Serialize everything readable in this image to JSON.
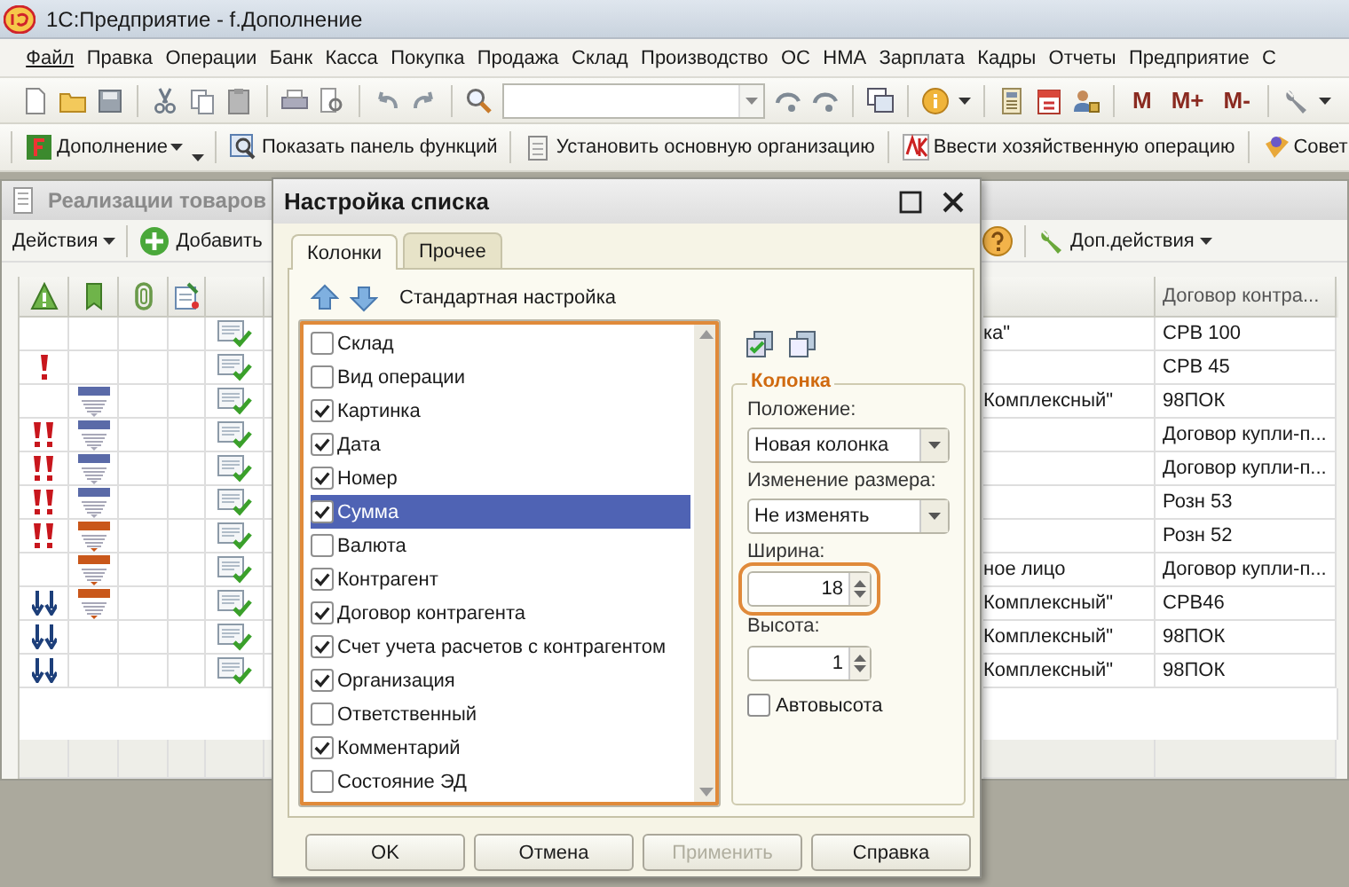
{
  "app": {
    "title": "1С:Предприятие - f.Дополнение"
  },
  "menu": [
    "Файл",
    "Правка",
    "Операции",
    "Банк",
    "Касса",
    "Покупка",
    "Продажа",
    "Склад",
    "Производство",
    "ОС",
    "НМА",
    "Зарплата",
    "Кадры",
    "Отчеты",
    "Предприятие",
    "С"
  ],
  "memory_buttons": [
    "M",
    "M+",
    "M-"
  ],
  "panel_buttons": [
    {
      "label": "Дополнение",
      "kind": "addon",
      "dropdown": true
    },
    {
      "label": "Показать панель функций",
      "kind": "panel",
      "dropdown": false
    },
    {
      "label": "Установить основную организацию",
      "kind": "organization",
      "dropdown": false
    },
    {
      "label": "Ввести хозяйственную операцию",
      "kind": "operation",
      "dropdown": false
    },
    {
      "label": "Совет",
      "kind": "tips",
      "dropdown": false
    }
  ],
  "document_window": {
    "title": "Реализации товаров",
    "actions": "Действия",
    "add": "Добавить",
    "more_actions": "Доп.действия",
    "header_contract": "Договор контра...",
    "rows": [
      {
        "counterparty": "ка\"",
        "contract": "СРВ 100"
      },
      {
        "priority": {
          "kind": "high"
        },
        "contract": "СРВ 45"
      },
      {
        "invoice": {
          "kind": "normal"
        },
        "counterparty": "Комплексный\"",
        "contract": "98ПОК"
      },
      {
        "priority": {
          "kind": "critical"
        },
        "invoice": {
          "kind": "normal"
        },
        "contract": "Договор купли-п..."
      },
      {
        "priority": {
          "kind": "critical"
        },
        "invoice": {
          "kind": "normal"
        },
        "contract": "Договор купли-п..."
      },
      {
        "priority": {
          "kind": "critical"
        },
        "invoice": {
          "kind": "normal"
        },
        "contract": "Розн 53"
      },
      {
        "priority": {
          "kind": "critical"
        },
        "invoice": {
          "kind": "attention"
        },
        "contract": "Розн 52"
      },
      {
        "invoice": {
          "kind": "attention"
        },
        "counterparty": "ное лицо",
        "contract": "Договор купли-п..."
      },
      {
        "priority": {
          "kind": "low"
        },
        "invoice": {
          "kind": "attention"
        },
        "counterparty": "Комплексный\"",
        "contract": "СРВ46"
      },
      {
        "priority": {
          "kind": "low"
        },
        "counterparty": "Комплексный\"",
        "contract": "98ПОК"
      },
      {
        "priority": {
          "kind": "low"
        },
        "counterparty": "Комплексный\"",
        "contract": "98ПОК"
      }
    ]
  },
  "dialog": {
    "title": "Настройка списка",
    "tabs": [
      {
        "label": "Колонки",
        "selected": true
      },
      {
        "label": "Прочее",
        "selected": false
      }
    ],
    "standard_settings": "Стандартная настройка",
    "list_highlighted": true,
    "columns": [
      {
        "label": "Склад",
        "checked": false,
        "selected": false
      },
      {
        "label": "Вид операции",
        "checked": false,
        "selected": false
      },
      {
        "label": "Картинка",
        "checked": true,
        "selected": false
      },
      {
        "label": "Дата",
        "checked": true,
        "selected": false
      },
      {
        "label": "Номер",
        "checked": true,
        "selected": false
      },
      {
        "label": "Сумма",
        "checked": true,
        "selected": true
      },
      {
        "label": "Валюта",
        "checked": false,
        "selected": false
      },
      {
        "label": "Контрагент",
        "checked": true,
        "selected": false
      },
      {
        "label": "Договор контрагента",
        "checked": true,
        "selected": false
      },
      {
        "label": "Счет учета расчетов с контрагентом",
        "checked": true,
        "selected": false
      },
      {
        "label": "Организация",
        "checked": true,
        "selected": false
      },
      {
        "label": "Ответственный",
        "checked": false,
        "selected": false
      },
      {
        "label": "Комментарий",
        "checked": true,
        "selected": false
      },
      {
        "label": "Состояние ЭД",
        "checked": false,
        "selected": false
      }
    ],
    "column_group": {
      "title": "Колонка",
      "position_label": "Положение:",
      "position_value": "Новая колонка",
      "resize_label": "Изменение размера:",
      "resize_value": "Не изменять",
      "width_label": "Ширина:",
      "width_value": "18",
      "width_highlighted": true,
      "height_label": "Высота:",
      "height_value": "1",
      "autoheight": {
        "label": "Автовысота",
        "checked": false
      }
    },
    "buttons": [
      {
        "label": "OK",
        "disabled": false
      },
      {
        "label": "Отмена",
        "disabled": false
      },
      {
        "label": "Применить",
        "disabled": true
      },
      {
        "label": "Справка",
        "disabled": false
      }
    ]
  }
}
